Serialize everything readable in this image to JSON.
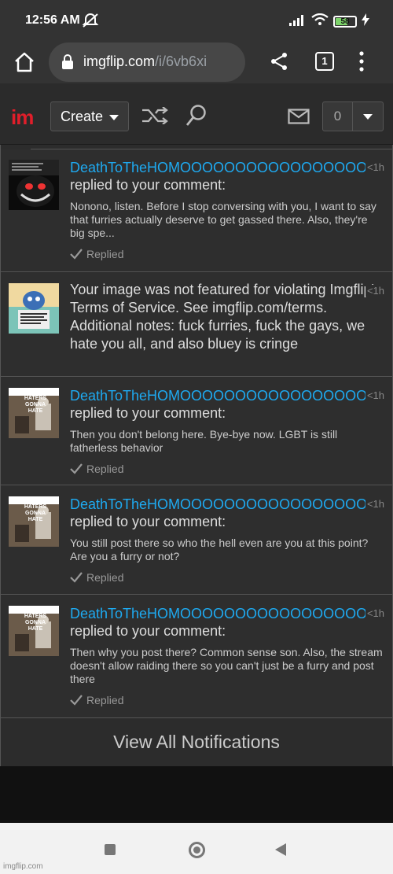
{
  "status_bar": {
    "time": "12:56 AM",
    "battery": "58",
    "icons": [
      "mute-icon",
      "signal-icon",
      "wifi-icon",
      "battery-icon",
      "charging-icon"
    ]
  },
  "browser": {
    "url_domain": "imgflip.com",
    "url_path": "/i/6vb6xi",
    "tab_count": "1"
  },
  "header": {
    "logo": "im",
    "create_label": "Create",
    "notification_count": "0"
  },
  "notifications": [
    {
      "username": "DeathToTheHOMOOOOOOOOOOOOOOOOOOO",
      "action": "replied to your comment:",
      "snippet": "Nonono, listen. Before I stop conversing with you, I want to say that furries actually deserve to get gassed there. Also, they're big spe...",
      "status": "Replied",
      "time": "<1h"
    },
    {
      "message": "Your image was not featured for violating Imgflip's Terms of Service. See imgflip.com/terms. Additional notes: fuck furries, fuck the gays, we hate you all, and also bluey is cringe",
      "time": "<1h"
    },
    {
      "username": "DeathToTheHOMOOOOOOOOOOOOOOOOOOO",
      "action": "replied to your comment:",
      "snippet": "Then you don't belong here. Bye-bye now. LGBT is still fatherless behavior",
      "status": "Replied",
      "time": "<1h"
    },
    {
      "username": "DeathToTheHOMOOOOOOOOOOOOOOOOOOO",
      "action": "replied to your comment:",
      "snippet": "You still post there so who the hell even are you at this point? Are you a furry or not?",
      "status": "Replied",
      "time": "<1h"
    },
    {
      "username": "DeathToTheHOMOOOOOOOOOOOOOOOOOOO",
      "action": "replied to your comment:",
      "snippet": "Then why you post there? Common sense son. Also, the stream doesn't allow raiding there so you can't just be a furry and post there",
      "status": "Replied",
      "time": "<1h"
    }
  ],
  "view_all_label": "View All Notifications",
  "thumb_text": {
    "haters": "HATERS GONNA HATE"
  },
  "watermark": "imgflip.com"
}
